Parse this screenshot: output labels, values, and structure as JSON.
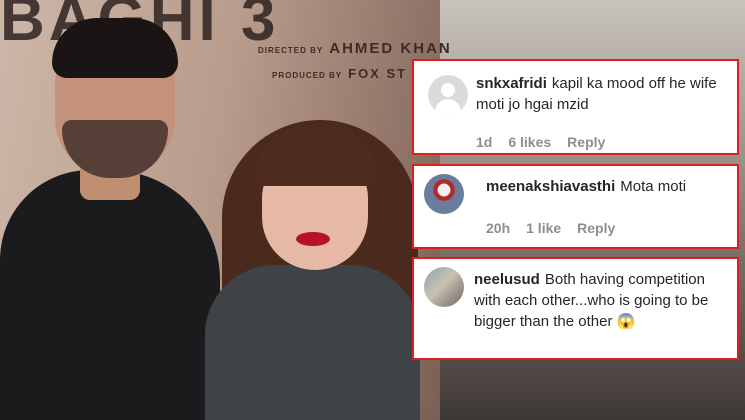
{
  "poster": {
    "title_fragment": "BAGHI 3",
    "director_prefix": "DIRECTED BY",
    "director": "AHMED KHAN",
    "producer_prefix": "PRODUCED BY",
    "producer": "FOX ST"
  },
  "comments": [
    {
      "username": "snkxafridi",
      "text": "kapil ka mood off he wife moti jo hgai mzid",
      "time": "1d",
      "likes": "6 likes",
      "reply": "Reply",
      "avatar": "default-avatar-icon"
    },
    {
      "username": "meenakshiavasthi",
      "text": "Mota moti",
      "time": "20h",
      "likes": "1 like",
      "reply": "Reply",
      "avatar": "photo-avatar"
    },
    {
      "username": "neelusud",
      "text": "Both having competition with each other...who is going to be bigger than the other 😱",
      "avatar": "photo-avatar"
    }
  ],
  "colors": {
    "highlight_border": "#e01e1e",
    "meta_text": "#8e8e8e",
    "comment_text": "#262626"
  }
}
